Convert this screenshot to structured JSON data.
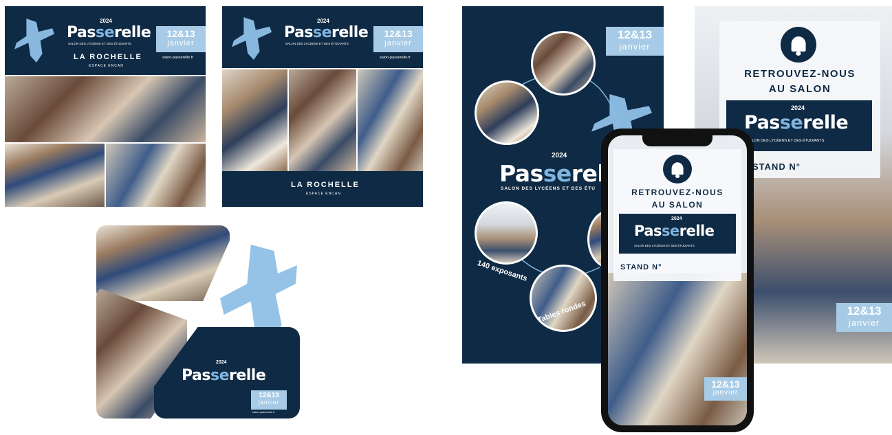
{
  "brand": {
    "year": "2024",
    "name_pre": "Pas",
    "name_mid": "se",
    "name_post": "relle",
    "subtitle": "SALON DES LYCÉENS ET DES ÉTUDIANTS",
    "subtitle_cut": "SALON DES LYCÉENS ET DES ÉTU",
    "date_days": "12&13",
    "date_month": "janvier",
    "website": "salon-passerelle.fr"
  },
  "location": {
    "city": "LA ROCHELLE",
    "venue": "ESPACE ENCAN"
  },
  "poster": {
    "caption1": "140 exposants",
    "caption2": "Tables rondes"
  },
  "reminder": {
    "line1": "RETROUVEZ-NOUS",
    "line2": "AU SALON",
    "stand": "STAND N°"
  },
  "colors": {
    "navy": "#0f2a44",
    "accent": "#7fb4df",
    "date_bg": "#a7cbe6"
  },
  "icons": [
    "bell-icon",
    "jumping-person-icon"
  ]
}
